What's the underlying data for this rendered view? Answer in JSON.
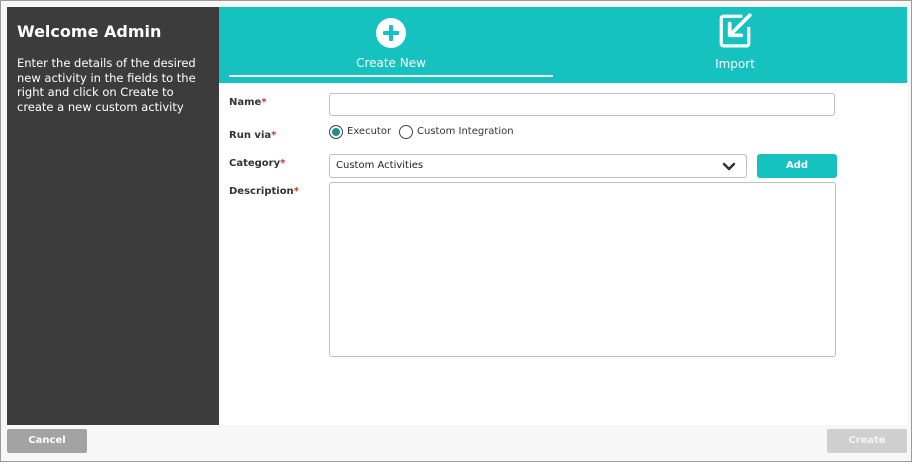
{
  "sidebar": {
    "title": "Welcome Admin",
    "description": "Enter the details of the desired new activity in the fields to the right and click on Create to create a new custom activity"
  },
  "tabs": [
    {
      "label": "Create New",
      "icon": "plus-circle-icon",
      "active": true
    },
    {
      "label": "Import",
      "icon": "import-icon",
      "active": false
    }
  ],
  "form": {
    "name": {
      "label": "Name",
      "required_mark": "*",
      "value": ""
    },
    "run_via": {
      "label": "Run via",
      "required_mark": "*",
      "options": [
        {
          "label": "Executor",
          "selected": true
        },
        {
          "label": "Custom Integration",
          "selected": false
        }
      ]
    },
    "category": {
      "label": "Category",
      "required_mark": "*",
      "value": "Custom Activities",
      "add_label": "Add"
    },
    "description": {
      "label": "Description",
      "required_mark": "*",
      "value": ""
    }
  },
  "footer": {
    "cancel_label": "Cancel",
    "create_label": "Create"
  },
  "colors": {
    "accent": "#16c2c0",
    "sidebar_bg": "#3c3c3c",
    "required": "#c0392b",
    "radio_selected": "#1a8f8d"
  }
}
